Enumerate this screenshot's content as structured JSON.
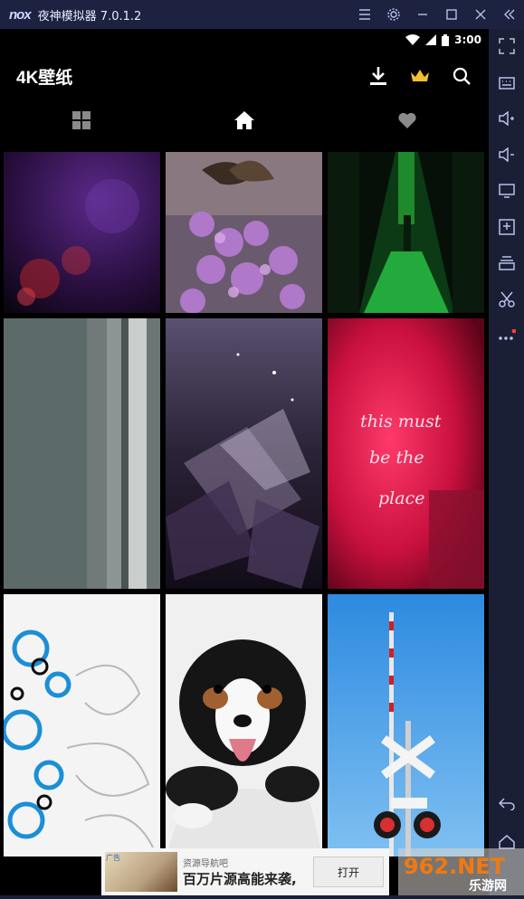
{
  "window": {
    "logo": "nox",
    "title": "夜神模拟器 7.0.1.2"
  },
  "statusbar": {
    "time": "3:00"
  },
  "app": {
    "title": "4K壁纸"
  },
  "ad": {
    "source": "资源导航吧",
    "headline": "百万片源高能来袭,",
    "button": "打开",
    "tag": "广告"
  },
  "watermark": {
    "brand": "962.NET",
    "sub": "乐游网"
  },
  "tiles": [
    "purple-bokeh",
    "butterfly-lavender",
    "green-corridor",
    "grey-stripes",
    "crystal-abstract",
    "neon-sign",
    "blue-swirls",
    "puppy",
    "railroad-crossing"
  ],
  "neon_text": [
    "this must",
    "be the",
    "place"
  ],
  "colors": {
    "titlebar": "#1c2240",
    "sidebar": "#1a1f36",
    "crown": "#f2c130",
    "sidebar_dot": "#ff3b3b"
  }
}
